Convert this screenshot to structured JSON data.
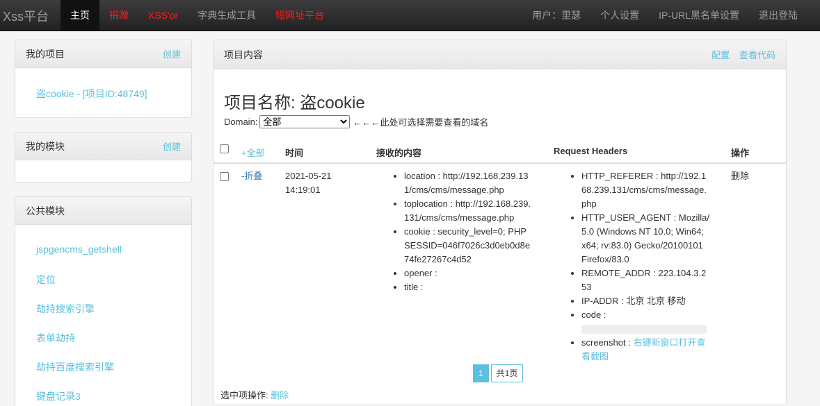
{
  "navbar": {
    "brand": "Xss平台",
    "items": [
      "主页",
      "捐赠",
      "XSS'or",
      "字典生成工具",
      "短网址平台"
    ],
    "right": [
      "用户：里瑟",
      "个人设置",
      "IP-URL黑名单设置",
      "退出登陆"
    ]
  },
  "projects_panel": {
    "title": "我的项目",
    "create": "创建",
    "item": "盗cookie - [项目ID:48749]"
  },
  "modules_panel": {
    "title": "我的模块",
    "create": "创建"
  },
  "public_panel": {
    "title": "公共模块",
    "items": [
      "jspgencms_getshell",
      "定位",
      "劫持搜索引擎",
      "表单劫持",
      "劫持百度搜索引擎",
      "键盘记录3"
    ]
  },
  "content_panel": {
    "title": "项目内容",
    "links": [
      "配置",
      "查看代码"
    ],
    "project_title": "项目名称: 盗cookie",
    "domain_label": "Domain:",
    "domain_value": "全部",
    "domain_hint": "←←←此处可选择需要查看的域名",
    "columns": {
      "expand_all": "+全部",
      "time": "时间",
      "received": "接收的内容",
      "headers": "Request Headers",
      "action": "操作"
    },
    "row": {
      "toggle": "-折叠",
      "time": "2021-05-21 14:19:01",
      "received": [
        "location : http://192.168.239.131/cms/cms/message.php",
        "toplocation : http://192.168.239.131/cms/cms/message.php",
        "cookie : security_level=0; PHPSESSID=046f7026c3d0eb0d8e74fe27267c4d52",
        "opener :",
        "title :"
      ],
      "headers": [
        "HTTP_REFERER : http://192.168.239.131/cms/cms/message.php",
        "HTTP_USER_AGENT : Mozilla/5.0 (Windows NT 10.0; Win64; x64; rv:83.0) Gecko/20100101 Firefox/83.0",
        "REMOTE_ADDR : 223.104.3.253",
        "IP-ADDR : 北京 北京 移动"
      ],
      "code_label": "code :",
      "screenshot_label": "screenshot :",
      "screenshot_link": "右键新窗口打开查看截图",
      "delete": "删除"
    },
    "pager": {
      "current": "1",
      "total": "共1页"
    },
    "batch_label": "选中项操作:",
    "batch_delete": "删除"
  }
}
